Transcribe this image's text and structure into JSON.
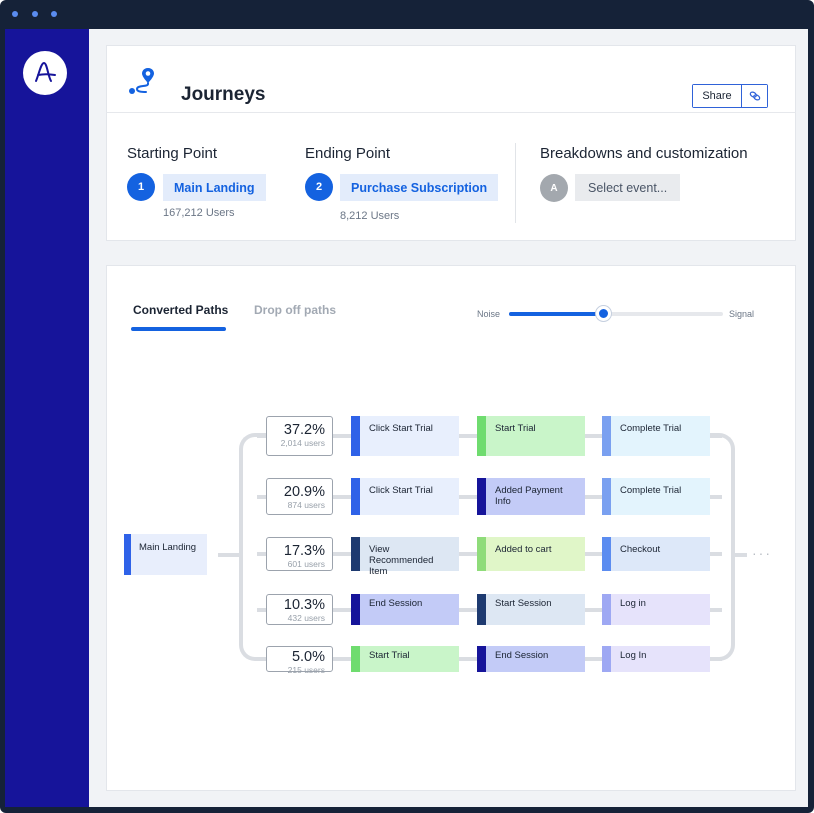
{
  "colors": {
    "window": "#152238",
    "sidebar": "#16149a",
    "accent": "#1462e0",
    "chip_bg": "#e3ecfb"
  },
  "icons": {
    "logo": "amplitude-logo-icon",
    "journeys": "journey-route-icon",
    "link": "link-icon"
  },
  "header": {
    "title": "Journeys",
    "share_label": "Share"
  },
  "points": {
    "starting": {
      "label": "Starting Point",
      "badge": "1",
      "event": "Main Landing",
      "users": "167,212 Users"
    },
    "ending": {
      "label": "Ending Point",
      "badge": "2",
      "event": "Purchase Subscription",
      "users": "8,212 Users"
    },
    "breakdowns": {
      "label": "Breakdowns and customization",
      "badge": "A",
      "placeholder": "Select event..."
    }
  },
  "tabs": [
    {
      "label": "Converted Paths",
      "active": true
    },
    {
      "label": "Drop off paths",
      "active": false
    }
  ],
  "slider": {
    "left_label": "Noise",
    "right_label": "Signal",
    "value": 0.44
  },
  "journey": {
    "start_node": "Main Landing",
    "paths": [
      {
        "pct": "37.2%",
        "users": "2,014 users",
        "steps": [
          {
            "label": "Click Start Trial",
            "bar": "#2f62e8",
            "bg": "#e8effd"
          },
          {
            "label": "Start Trial",
            "bar": "#6fdc6f",
            "bg": "#c9f5c9"
          },
          {
            "label": "Complete Trial",
            "bar": "#7aa0f0",
            "bg": "#e3f4fd"
          }
        ]
      },
      {
        "pct": "20.9%",
        "users": "874 users",
        "steps": [
          {
            "label": "Click Start Trial",
            "bar": "#2f62e8",
            "bg": "#e8effd"
          },
          {
            "label": "Added Payment Info",
            "bar": "#16149a",
            "bg": "#c3cbf7"
          },
          {
            "label": "Complete Trial",
            "bar": "#7aa0f0",
            "bg": "#e3f4fd"
          }
        ]
      },
      {
        "pct": "17.3%",
        "users": "601 users",
        "steps": [
          {
            "label": "View Recommended Item",
            "bar": "#1e3a70",
            "bg": "#dde7f3"
          },
          {
            "label": "Added to cart",
            "bar": "#8fdc7a",
            "bg": "#e0f6c8"
          },
          {
            "label": "Checkout",
            "bar": "#5b8cf0",
            "bg": "#dde8f9"
          }
        ]
      },
      {
        "pct": "10.3%",
        "users": "432 users",
        "steps": [
          {
            "label": "End Session",
            "bar": "#16149a",
            "bg": "#c3cbf7"
          },
          {
            "label": "Start Session",
            "bar": "#1e3a70",
            "bg": "#dde7f3"
          },
          {
            "label": "Log in",
            "bar": "#9ea8f3",
            "bg": "#e6e3fb"
          }
        ]
      },
      {
        "pct": "5.0%",
        "users": "215 users",
        "steps": [
          {
            "label": "Start Trial",
            "bar": "#6fdc6f",
            "bg": "#c9f5c9"
          },
          {
            "label": "End Session",
            "bar": "#16149a",
            "bg": "#c3cbf7"
          },
          {
            "label": "Log In",
            "bar": "#9ea8f3",
            "bg": "#e6e3fb"
          }
        ]
      }
    ],
    "more": "···"
  }
}
